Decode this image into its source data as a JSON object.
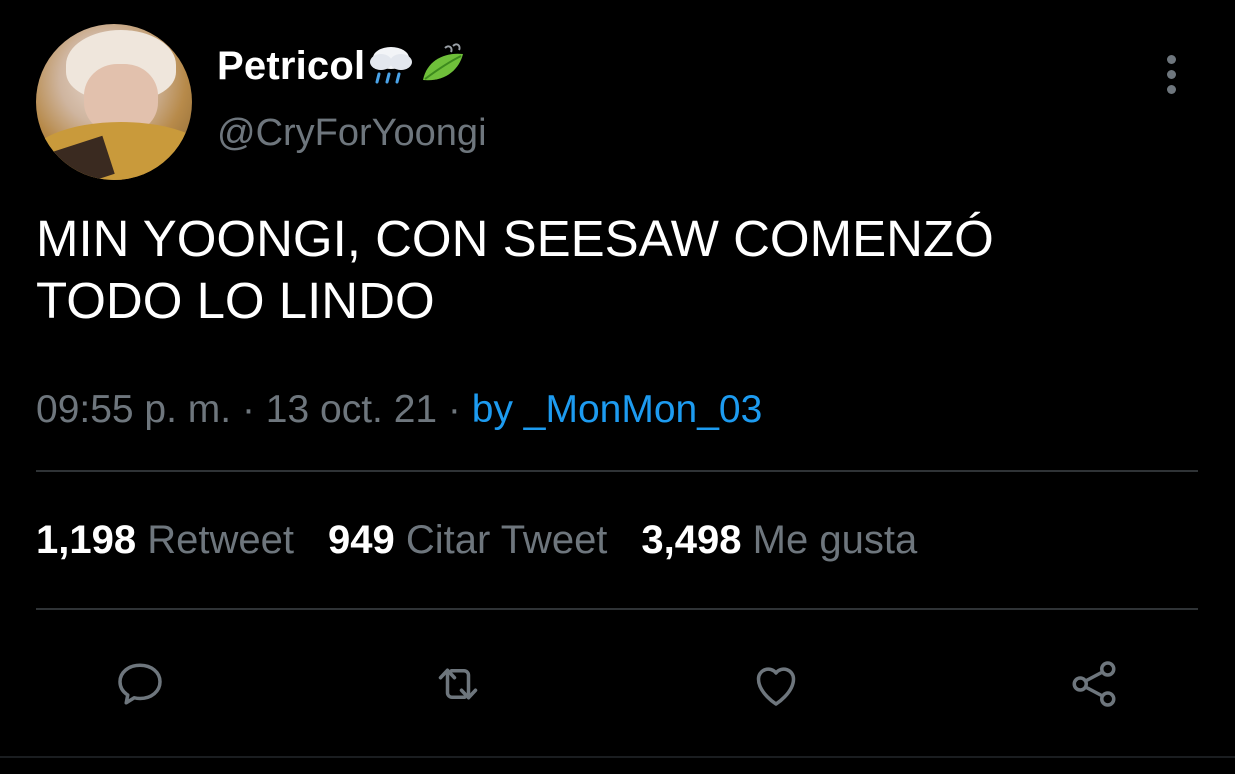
{
  "user": {
    "display_name": "Petricol",
    "name_emojis": "🌧️🍃",
    "handle": "@CryForYoongi"
  },
  "tweet": {
    "text_line1": "MIN YOONGI, CON SEESAW COMENZÓ",
    "text_line2": "TODO LO LINDO",
    "time": "09:55 p. m.",
    "sep1": " · ",
    "date": "13 oct. 21",
    "sep2": " · ",
    "source": "by _MonMon_03"
  },
  "stats": {
    "retweets_count": "1,198",
    "retweets_label": "Retweet",
    "quotes_count": "949",
    "quotes_label": "Citar Tweet",
    "likes_count": "3,498",
    "likes_label": "Me gusta"
  },
  "actions": {
    "icons": [
      "reply-icon",
      "retweet-icon",
      "like-icon",
      "share-icon"
    ]
  },
  "colors": {
    "background": "#000000",
    "primary_text": "#ffffff",
    "secondary_text": "#6e767d",
    "link": "#1d9bf0",
    "divider": "#2f3336"
  }
}
